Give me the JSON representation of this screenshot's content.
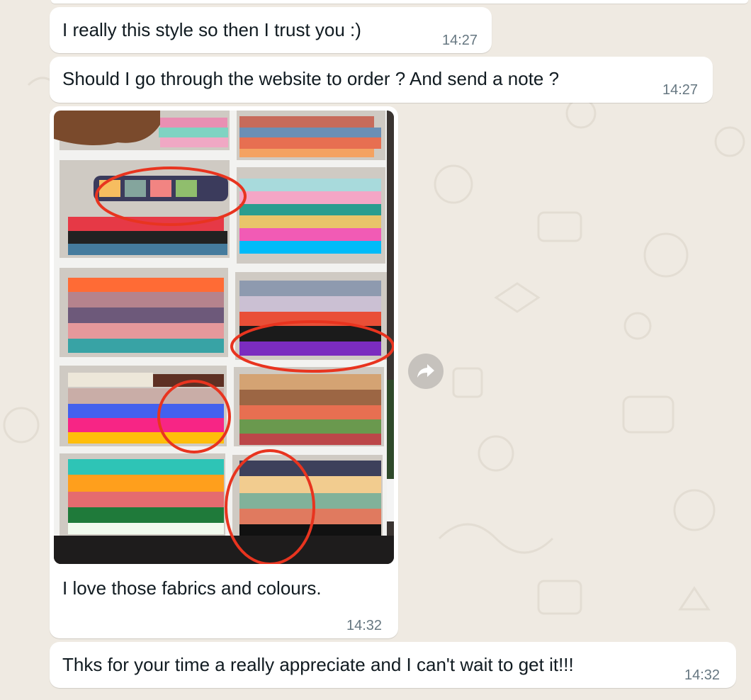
{
  "chat": {
    "messages": [
      {
        "text": "I really this style so then I trust you :)",
        "time": "14:27"
      },
      {
        "text": "Should I go through the website to order ? And send a note ?",
        "time": "14:27"
      },
      {
        "type": "image",
        "caption": "I love those fabrics and colours.",
        "time": "14:32",
        "image_label": "bookshelf-with-crochet-blankets"
      },
      {
        "text": "Thks for your time a really appreciate and I can't wait to get it!!!",
        "time": "14:32"
      }
    ]
  },
  "colors": {
    "background": "#efeae2",
    "bubble": "#ffffff",
    "text": "#111b21",
    "timestamp": "#667781",
    "highlight_circle": "#e8341f"
  },
  "icons": {
    "forward": "forward-arrow-icon"
  }
}
